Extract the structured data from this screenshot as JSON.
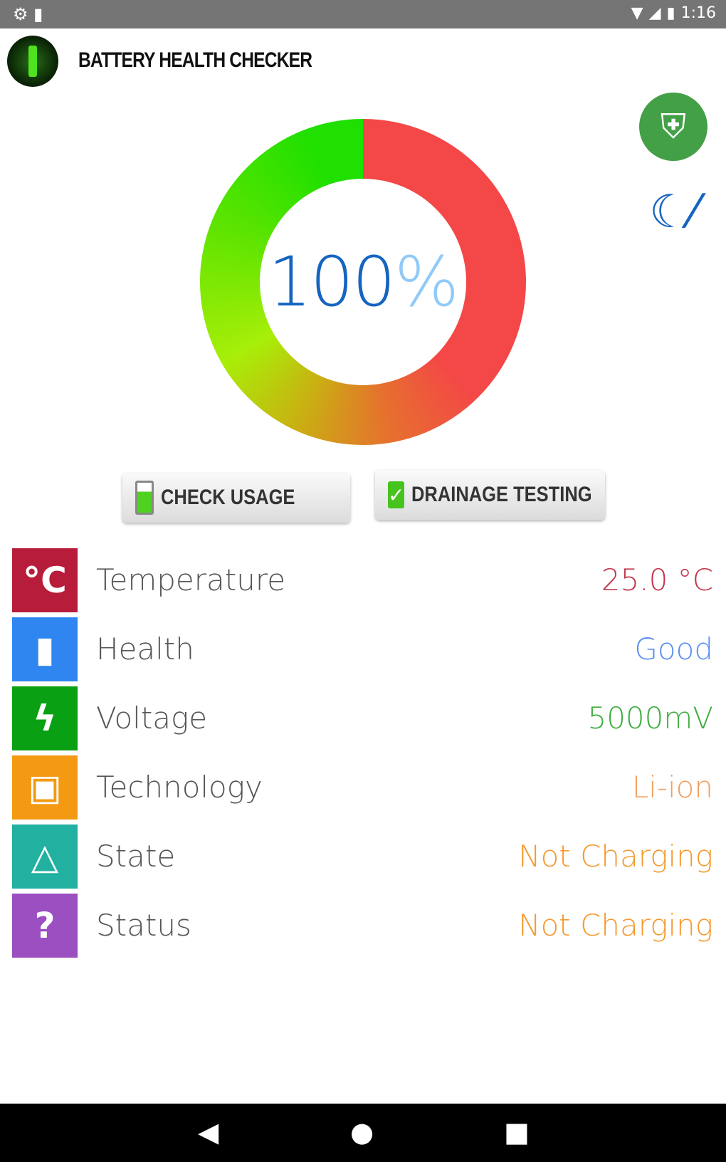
{
  "status_bar": {
    "time": "1:16",
    "left_icons": [
      "settings-icon",
      "sd-card-icon"
    ],
    "right_icons": [
      "wifi-icon",
      "signal-icon",
      "battery-icon"
    ]
  },
  "app": {
    "title": "BATTERY HEALTH CHECKER"
  },
  "gauge": {
    "level_percent": 100,
    "value": "100",
    "unit": "%",
    "colors": {
      "good": "#1fe000",
      "mid": "#a8ee08",
      "bad": "#f44747"
    }
  },
  "buttons": {
    "check_usage": "CHECK USAGE",
    "drainage_testing": "DRAINAGE TESTING"
  },
  "rows": [
    {
      "label": "Temperature",
      "value": "25.0 °C",
      "icon": "celsius-icon",
      "icon_bg": "#b71c3a",
      "value_color": "#c2384f"
    },
    {
      "label": "Health",
      "value": "Good",
      "icon": "battery-icon",
      "icon_bg": "#2f86f0",
      "value_color": "#5a8ff0"
    },
    {
      "label": "Voltage",
      "value": "5000mV",
      "icon": "lightning-icon",
      "icon_bg": "#0aa014",
      "value_color": "#3fae3f"
    },
    {
      "label": "Technology",
      "value": "Li-ion",
      "icon": "chip-icon",
      "icon_bg": "#f39a12",
      "value_color": "#f0a060"
    },
    {
      "label": "State",
      "value": "Not Charging",
      "icon": "network-icon",
      "icon_bg": "#22b1a0",
      "value_color": "#f59a30"
    },
    {
      "label": "Status",
      "value": "Not Charging",
      "icon": "battery-unknown-icon",
      "icon_bg": "#9b4fc1",
      "value_color": "#f59a30"
    }
  ]
}
